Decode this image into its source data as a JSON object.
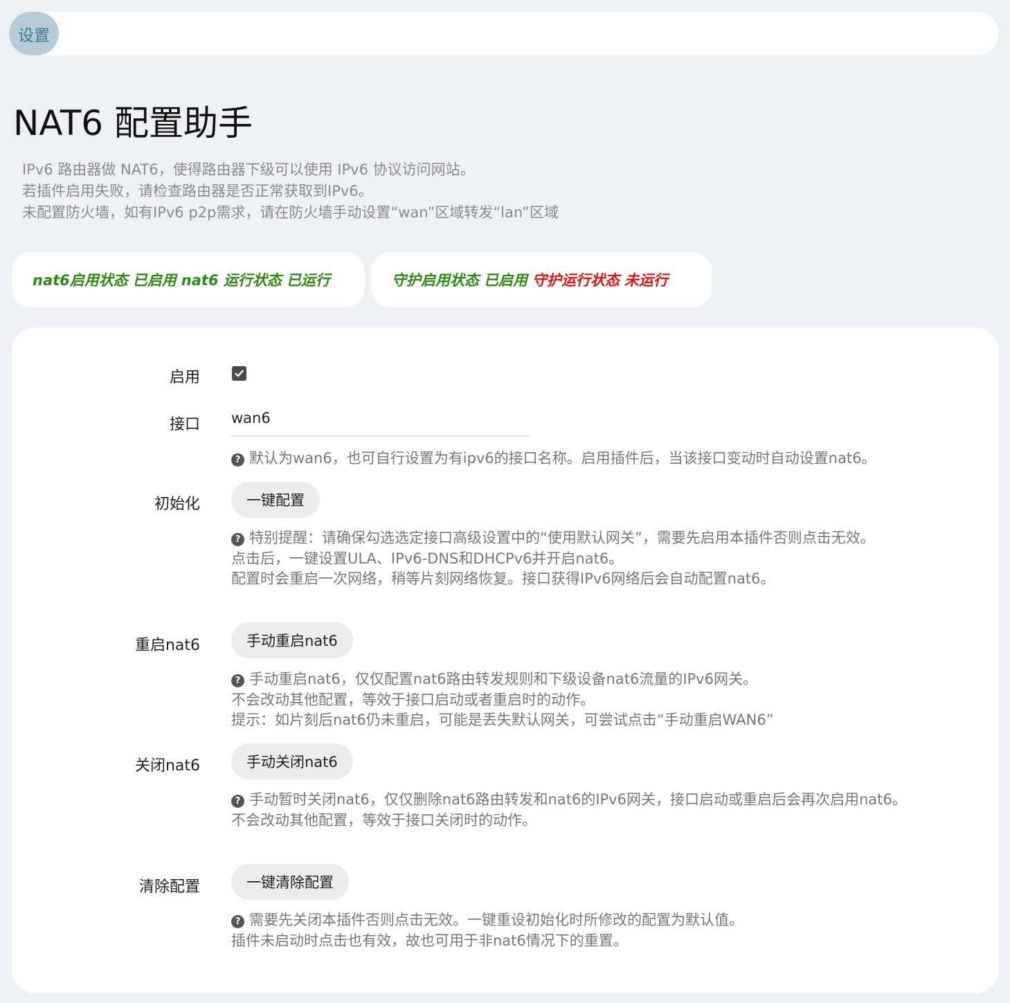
{
  "tabs": [
    {
      "label": "设置"
    }
  ],
  "page": {
    "title": "NAT6 配置助手",
    "description": [
      "IPv6 路由器做 NAT6，使得路由器下级可以使用 IPv6 协议访问网站。",
      "若插件启用失败，请检查路由器是否正常获取到IPv6。",
      "未配置防火墙，如有IPv6 p2p需求，请在防火墙手动设置“wan”区域转发“lan”区域"
    ]
  },
  "status": {
    "nat6_enabled_label": "nat6启用状态",
    "nat6_enabled_value": "已启用",
    "nat6_running_label": "nat6 运行状态",
    "nat6_running_value": "已运行",
    "guard_enabled_label": "守护启用状态",
    "guard_enabled_value": "已启用",
    "guard_running_label": "守护运行状态",
    "guard_running_value": "未运行",
    "colors": {
      "ok": "#2d8a14",
      "error": "#e01414"
    }
  },
  "form": {
    "enable": {
      "label": "启用",
      "checked": true
    },
    "interface": {
      "label": "接口",
      "value": "wan6",
      "help": "默认为wan6，也可自行设置为有ipv6的接口名称。启用插件后，当该接口变动时自动设置nat6。"
    },
    "init": {
      "label": "初始化",
      "button": "一键配置",
      "help": [
        "特别提醒：请确保勾选选定接口高级设置中的“使用默认网关”，需要先启用本插件否则点击无效。",
        "点击后，一键设置ULA、IPv6-DNS和DHCPv6并开启nat6。",
        "配置时会重启一次网络，稍等片刻网络恢复。接口获得IPv6网络后会自动配置nat6。"
      ]
    },
    "restart": {
      "label": "重启nat6",
      "button": "手动重启nat6",
      "help": [
        "手动重启nat6，仅仅配置nat6路由转发规则和下级设备nat6流量的IPv6网关。",
        "不会改动其他配置，等效于接口启动或者重启时的动作。",
        "提示：如片刻后nat6仍未重启，可能是丢失默认网关，可尝试点击“手动重启WAN6”"
      ]
    },
    "stop": {
      "label": "关闭nat6",
      "button": "手动关闭nat6",
      "help": [
        "手动暂时关闭nat6，仅仅删除nat6路由转发和nat6的IPv6网关，接口启动或重启后会再次启用nat6。",
        "不会改动其他配置，等效于接口关闭时的动作。"
      ]
    },
    "clear": {
      "label": "清除配置",
      "button": "一键清除配置",
      "help": [
        "需要先关闭本插件否则点击无效。一键重设初始化时所修改的配置为默认值。",
        "插件未启动时点击也有效，故也可用于非nat6情况下的重置。"
      ]
    }
  }
}
